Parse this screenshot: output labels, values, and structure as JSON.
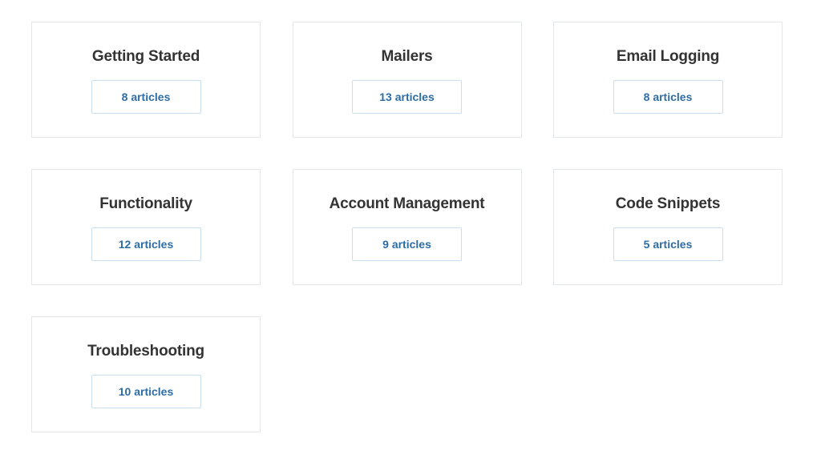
{
  "categories": [
    {
      "title": "Getting Started",
      "count_label": "8 articles"
    },
    {
      "title": "Mailers",
      "count_label": "13 articles"
    },
    {
      "title": "Email Logging",
      "count_label": "8 articles"
    },
    {
      "title": "Functionality",
      "count_label": "12 articles"
    },
    {
      "title": "Account Management",
      "count_label": "9 articles"
    },
    {
      "title": "Code Snippets",
      "count_label": "5 articles"
    },
    {
      "title": "Troubleshooting",
      "count_label": "10 articles"
    }
  ],
  "colors": {
    "title": "#333333",
    "link": "#2e6da4",
    "card_border": "#e4e7ea",
    "button_border": "#c9dfef"
  }
}
